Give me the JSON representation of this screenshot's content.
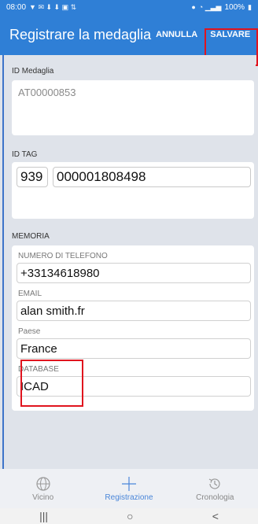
{
  "status_bar": {
    "time": "08:00",
    "battery": "100%"
  },
  "app_bar": {
    "title": "Registrare la medaglia",
    "cancel_label": "ANNULLA",
    "save_label": "SALVARE"
  },
  "medal": {
    "section_label": "ID Medaglia",
    "value": "AT00000853"
  },
  "tag": {
    "section_label": "ID TAG",
    "prefix": "939",
    "number": "000001808498"
  },
  "memory": {
    "section_label": "MEMORIA",
    "fields": [
      {
        "label": "NUMERO DI TELEFONO",
        "value": "+33134618980"
      },
      {
        "label": "EMAIL",
        "value": "alan smith.fr"
      },
      {
        "label": "Paese",
        "value": "France"
      },
      {
        "label": "DATABASE",
        "value": "ICAD"
      }
    ]
  },
  "bottom_nav": {
    "items": [
      {
        "label": "Vicino",
        "icon": "globe-icon"
      },
      {
        "label": "Registrazione",
        "icon": "plus-icon"
      },
      {
        "label": "Cronologia",
        "icon": "history-icon"
      }
    ]
  },
  "system_nav": {
    "recent": "|||",
    "home": "○",
    "back": "<"
  },
  "colors": {
    "primary": "#2f7fd6",
    "highlight": "#e0141e",
    "active_nav": "#4a86d9"
  }
}
